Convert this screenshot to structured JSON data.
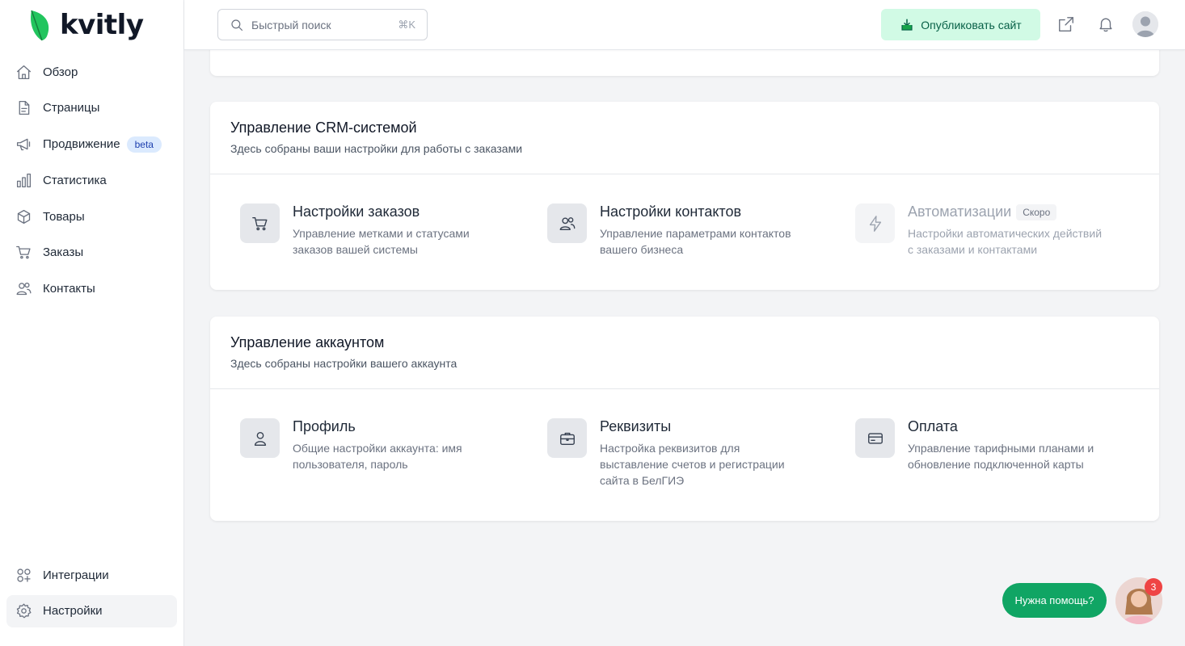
{
  "brand": {
    "name": "kvitly",
    "color": "#22c55e"
  },
  "sidebar": {
    "items": [
      {
        "label": "Обзор",
        "icon": "home-icon"
      },
      {
        "label": "Страницы",
        "icon": "document-icon"
      },
      {
        "label": "Продвижение",
        "icon": "megaphone-icon",
        "badge": "beta"
      },
      {
        "label": "Статистика",
        "icon": "bar-chart-icon"
      },
      {
        "label": "Товары",
        "icon": "box-icon"
      },
      {
        "label": "Заказы",
        "icon": "cart-icon"
      },
      {
        "label": "Контакты",
        "icon": "users-icon"
      }
    ],
    "bottom": [
      {
        "label": "Интеграции",
        "icon": "integrations-icon"
      },
      {
        "label": "Настройки",
        "icon": "gear-icon",
        "active": true
      }
    ]
  },
  "topbar": {
    "search_placeholder": "Быстрый поиск",
    "search_shortcut": "⌘K",
    "publish_label": "Опубликовать сайт"
  },
  "crm": {
    "title": "Управление CRM-системой",
    "subtitle": "Здесь собраны ваши настройки для работы с заказами",
    "items": [
      {
        "title": "Настройки заказов",
        "desc1": "Управление метками и статусами",
        "desc2": "заказов вашей системы",
        "icon": "cart-icon"
      },
      {
        "title": "Настройки контактов",
        "desc1": "Управление параметрами контактов",
        "desc2": "вашего бизнеса",
        "icon": "users-icon"
      },
      {
        "title": "Автоматизации",
        "badge": "Скоро",
        "desc1": "Настройки автоматических действий",
        "desc2": "с заказами и контактами",
        "icon": "lightning-icon",
        "disabled": true
      }
    ]
  },
  "account": {
    "title": "Управление аккаунтом",
    "subtitle": "Здесь собраны настройки вашего аккаунта",
    "items": [
      {
        "title": "Профиль",
        "desc1": "Общие настройки аккаунта: имя",
        "desc2": "пользователя, пароль",
        "icon": "user-icon"
      },
      {
        "title": "Реквизиты",
        "desc1": "Настройка реквизитов для",
        "desc2": "выставление счетов и регистрации",
        "desc3": "сайта в БелГИЭ",
        "icon": "briefcase-icon"
      },
      {
        "title": "Оплата",
        "desc1": "Управление тарифными планами и",
        "desc2": "обновление подключенной карты",
        "icon": "credit-card-icon"
      }
    ]
  },
  "help": {
    "label": "Нужна помощь?",
    "count": "3"
  }
}
